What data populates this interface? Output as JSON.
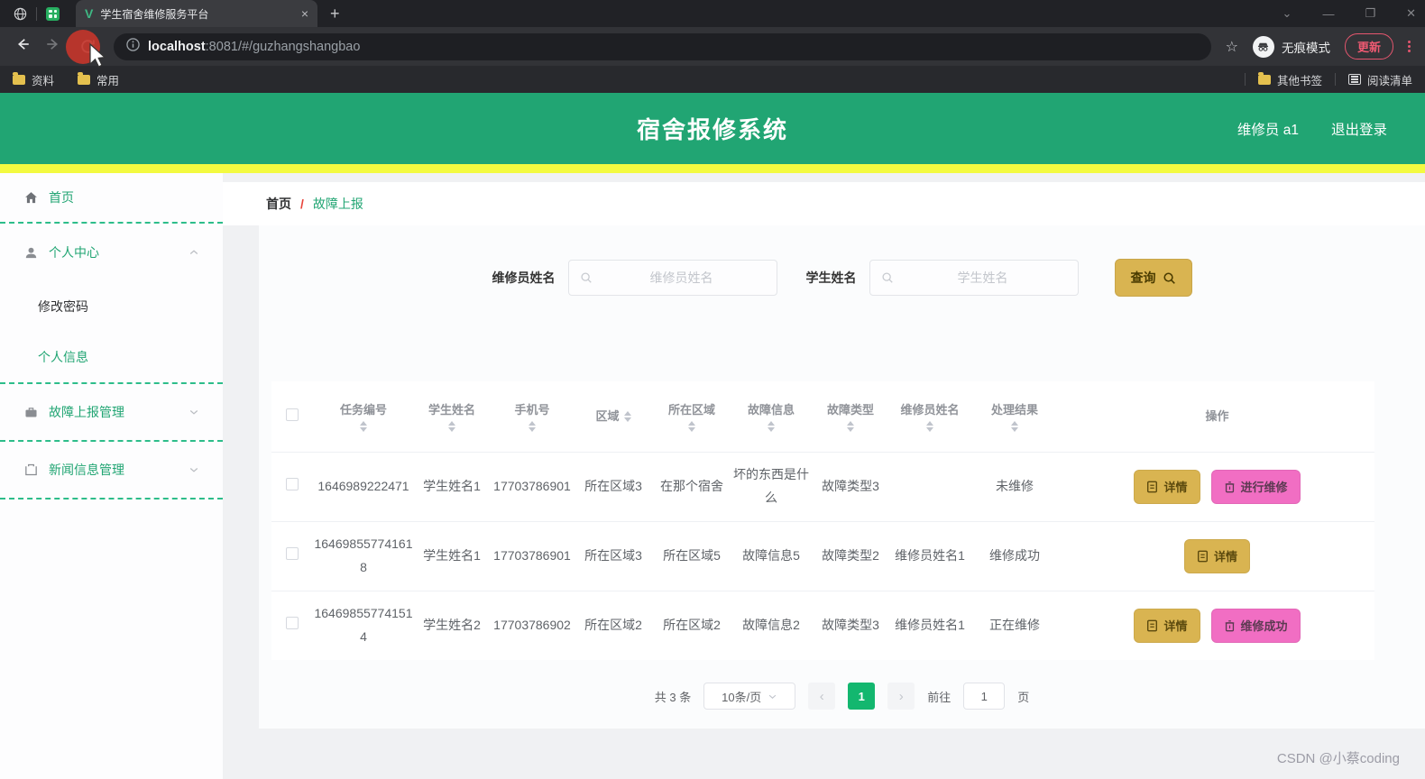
{
  "colors": {
    "green": "#21a573",
    "yellow": "#f3fa40",
    "gold": "#d9b451",
    "pink": "#f16ec3",
    "page-active": "#13b76f"
  },
  "browser": {
    "tab_title": "学生宿舍维修服务平台",
    "url_host": "localhost",
    "url_rest": ":8081/#/guzhangshangbao",
    "incognito_label": "无痕模式",
    "update_label": "更新",
    "bookmark_1": "资料",
    "bookmark_2": "常用",
    "bookmark_other": "其他书签",
    "bookmark_reading": "阅读清单"
  },
  "header": {
    "title": "宿舍报修系统",
    "user": "维修员 a1",
    "logout": "退出登录"
  },
  "sidebar": {
    "home": "首页",
    "personal_center": "个人中心",
    "change_password": "修改密码",
    "personal_info": "个人信息",
    "fault_report_mgmt": "故障上报管理",
    "news_info_mgmt": "新闻信息管理"
  },
  "breadcrumb": {
    "home": "首页",
    "sep": "/",
    "current": "故障上报"
  },
  "search": {
    "worker_label": "维修员姓名",
    "worker_placeholder": "维修员姓名",
    "student_label": "学生姓名",
    "student_placeholder": "学生姓名",
    "submit": "查询"
  },
  "table": {
    "headers": [
      "任务编号",
      "学生姓名",
      "手机号",
      "区域",
      "所在区域",
      "故障信息",
      "故障类型",
      "维修员姓名",
      "处理结果",
      "操作"
    ],
    "rows": [
      {
        "task_no": "1646989222471",
        "student": "学生姓名1",
        "phone": "17703786901",
        "area": "所在区域3",
        "location": "在那个宿舍",
        "fault_info": "坏的东西是什么",
        "fault_type": "故障类型3",
        "worker": "",
        "result": "未维修",
        "actions": [
          "详情",
          "进行维修"
        ]
      },
      {
        "task_no": "164698557741618",
        "student": "学生姓名1",
        "phone": "17703786901",
        "area": "所在区域3",
        "location": "所在区域5",
        "fault_info": "故障信息5",
        "fault_type": "故障类型2",
        "worker": "维修员姓名1",
        "result": "维修成功",
        "actions": [
          "详情"
        ]
      },
      {
        "task_no": "164698557741514",
        "student": "学生姓名2",
        "phone": "17703786902",
        "area": "所在区域2",
        "location": "所在区域2",
        "fault_info": "故障信息2",
        "fault_type": "故障类型3",
        "worker": "维修员姓名1",
        "result": "正在维修",
        "actions": [
          "详情",
          "维修成功"
        ]
      }
    ]
  },
  "pagination": {
    "total": "共 3 条",
    "page_size": "10条/页",
    "current_page": "1",
    "goto_label": "前往",
    "goto_value": "1",
    "page_label": "页"
  },
  "watermark": "CSDN @小蔡coding"
}
